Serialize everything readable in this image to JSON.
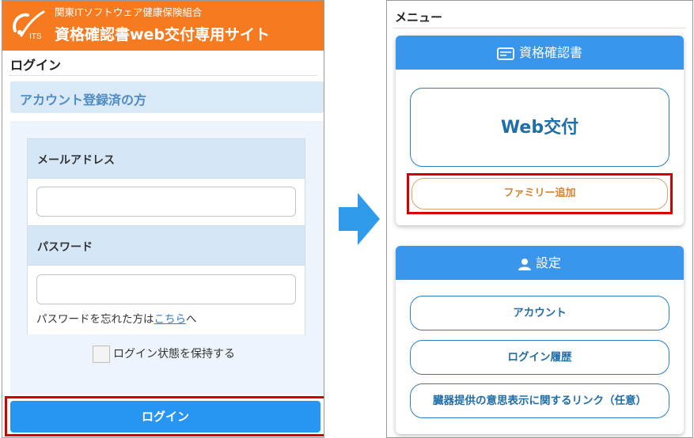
{
  "left_screen": {
    "header": {
      "org_name": "関東ITソフトウェア健康保険組合",
      "site_title": "資格確認書web交付専用サイト",
      "logo_icon": "its-logo-icon",
      "logo_text": "ITS",
      "color": "#f57a20"
    },
    "login_heading": "ログイン",
    "account_section": "アカウント登録済の方",
    "form": {
      "email_label": "メールアドレス",
      "email_value": "",
      "password_label": "パスワード",
      "password_value": "",
      "forgot_prefix": "パスワードを忘れた方は",
      "forgot_link": "こちら",
      "forgot_suffix": "へ",
      "remember_label": "ログイン状態を保持する",
      "remember_checked": false
    },
    "login_button": "ログイン"
  },
  "arrow_icon": "right-arrow-icon",
  "right_screen": {
    "menu_label": "メニュー",
    "qualification_card": {
      "title": "資格確認書",
      "icon": "card-icon",
      "web_button": "Web交付",
      "family_button": "ファミリー追加"
    },
    "settings_card": {
      "title": "設定",
      "icon": "user-icon",
      "buttons": [
        "アカウント",
        "ログイン履歴",
        "臓器提供の意思表示に関するリンク（任意）"
      ]
    }
  },
  "colors": {
    "primary_blue": "#2796f2",
    "header_orange": "#f57a20",
    "highlight_red": "#d40000"
  }
}
